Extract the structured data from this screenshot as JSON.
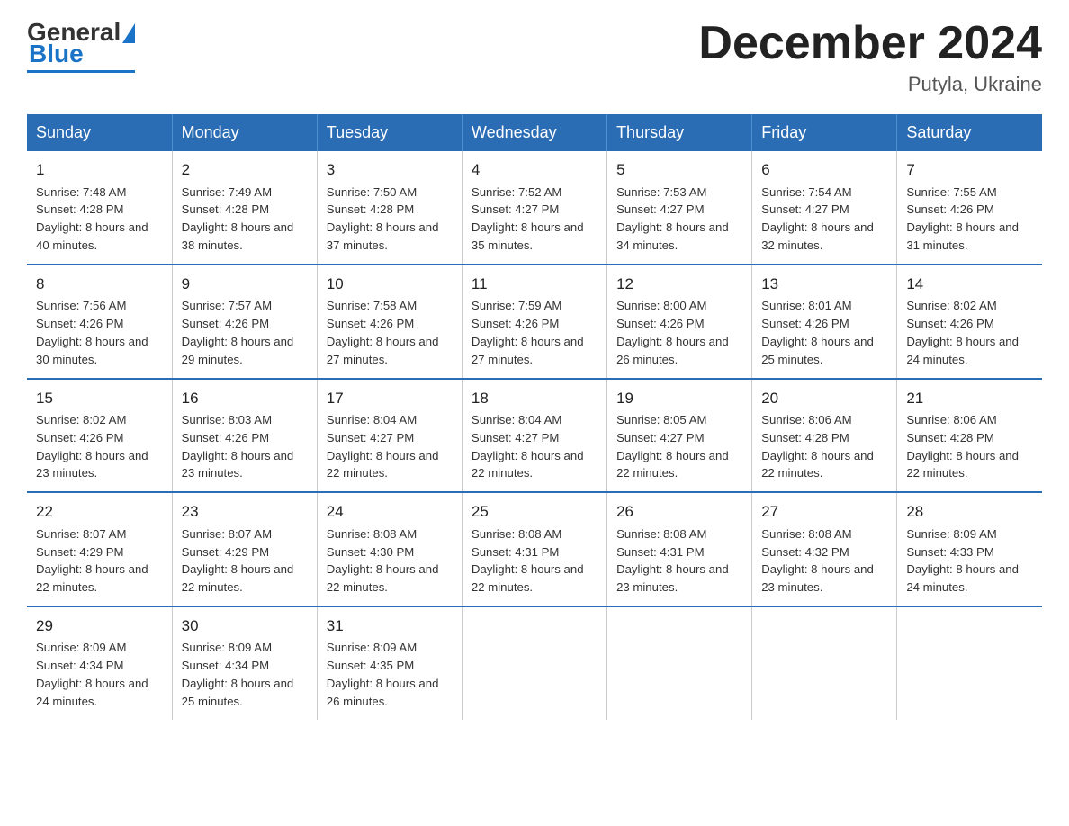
{
  "header": {
    "logo_general": "General",
    "logo_blue": "Blue",
    "title": "December 2024",
    "subtitle": "Putyla, Ukraine"
  },
  "weekdays": [
    "Sunday",
    "Monday",
    "Tuesday",
    "Wednesday",
    "Thursday",
    "Friday",
    "Saturday"
  ],
  "weeks": [
    [
      {
        "day": "1",
        "sunrise": "7:48 AM",
        "sunset": "4:28 PM",
        "daylight": "8 hours and 40 minutes."
      },
      {
        "day": "2",
        "sunrise": "7:49 AM",
        "sunset": "4:28 PM",
        "daylight": "8 hours and 38 minutes."
      },
      {
        "day": "3",
        "sunrise": "7:50 AM",
        "sunset": "4:28 PM",
        "daylight": "8 hours and 37 minutes."
      },
      {
        "day": "4",
        "sunrise": "7:52 AM",
        "sunset": "4:27 PM",
        "daylight": "8 hours and 35 minutes."
      },
      {
        "day": "5",
        "sunrise": "7:53 AM",
        "sunset": "4:27 PM",
        "daylight": "8 hours and 34 minutes."
      },
      {
        "day": "6",
        "sunrise": "7:54 AM",
        "sunset": "4:27 PM",
        "daylight": "8 hours and 32 minutes."
      },
      {
        "day": "7",
        "sunrise": "7:55 AM",
        "sunset": "4:26 PM",
        "daylight": "8 hours and 31 minutes."
      }
    ],
    [
      {
        "day": "8",
        "sunrise": "7:56 AM",
        "sunset": "4:26 PM",
        "daylight": "8 hours and 30 minutes."
      },
      {
        "day": "9",
        "sunrise": "7:57 AM",
        "sunset": "4:26 PM",
        "daylight": "8 hours and 29 minutes."
      },
      {
        "day": "10",
        "sunrise": "7:58 AM",
        "sunset": "4:26 PM",
        "daylight": "8 hours and 27 minutes."
      },
      {
        "day": "11",
        "sunrise": "7:59 AM",
        "sunset": "4:26 PM",
        "daylight": "8 hours and 27 minutes."
      },
      {
        "day": "12",
        "sunrise": "8:00 AM",
        "sunset": "4:26 PM",
        "daylight": "8 hours and 26 minutes."
      },
      {
        "day": "13",
        "sunrise": "8:01 AM",
        "sunset": "4:26 PM",
        "daylight": "8 hours and 25 minutes."
      },
      {
        "day": "14",
        "sunrise": "8:02 AM",
        "sunset": "4:26 PM",
        "daylight": "8 hours and 24 minutes."
      }
    ],
    [
      {
        "day": "15",
        "sunrise": "8:02 AM",
        "sunset": "4:26 PM",
        "daylight": "8 hours and 23 minutes."
      },
      {
        "day": "16",
        "sunrise": "8:03 AM",
        "sunset": "4:26 PM",
        "daylight": "8 hours and 23 minutes."
      },
      {
        "day": "17",
        "sunrise": "8:04 AM",
        "sunset": "4:27 PM",
        "daylight": "8 hours and 22 minutes."
      },
      {
        "day": "18",
        "sunrise": "8:04 AM",
        "sunset": "4:27 PM",
        "daylight": "8 hours and 22 minutes."
      },
      {
        "day": "19",
        "sunrise": "8:05 AM",
        "sunset": "4:27 PM",
        "daylight": "8 hours and 22 minutes."
      },
      {
        "day": "20",
        "sunrise": "8:06 AM",
        "sunset": "4:28 PM",
        "daylight": "8 hours and 22 minutes."
      },
      {
        "day": "21",
        "sunrise": "8:06 AM",
        "sunset": "4:28 PM",
        "daylight": "8 hours and 22 minutes."
      }
    ],
    [
      {
        "day": "22",
        "sunrise": "8:07 AM",
        "sunset": "4:29 PM",
        "daylight": "8 hours and 22 minutes."
      },
      {
        "day": "23",
        "sunrise": "8:07 AM",
        "sunset": "4:29 PM",
        "daylight": "8 hours and 22 minutes."
      },
      {
        "day": "24",
        "sunrise": "8:08 AM",
        "sunset": "4:30 PM",
        "daylight": "8 hours and 22 minutes."
      },
      {
        "day": "25",
        "sunrise": "8:08 AM",
        "sunset": "4:31 PM",
        "daylight": "8 hours and 22 minutes."
      },
      {
        "day": "26",
        "sunrise": "8:08 AM",
        "sunset": "4:31 PM",
        "daylight": "8 hours and 23 minutes."
      },
      {
        "day": "27",
        "sunrise": "8:08 AM",
        "sunset": "4:32 PM",
        "daylight": "8 hours and 23 minutes."
      },
      {
        "day": "28",
        "sunrise": "8:09 AM",
        "sunset": "4:33 PM",
        "daylight": "8 hours and 24 minutes."
      }
    ],
    [
      {
        "day": "29",
        "sunrise": "8:09 AM",
        "sunset": "4:34 PM",
        "daylight": "8 hours and 24 minutes."
      },
      {
        "day": "30",
        "sunrise": "8:09 AM",
        "sunset": "4:34 PM",
        "daylight": "8 hours and 25 minutes."
      },
      {
        "day": "31",
        "sunrise": "8:09 AM",
        "sunset": "4:35 PM",
        "daylight": "8 hours and 26 minutes."
      },
      null,
      null,
      null,
      null
    ]
  ]
}
